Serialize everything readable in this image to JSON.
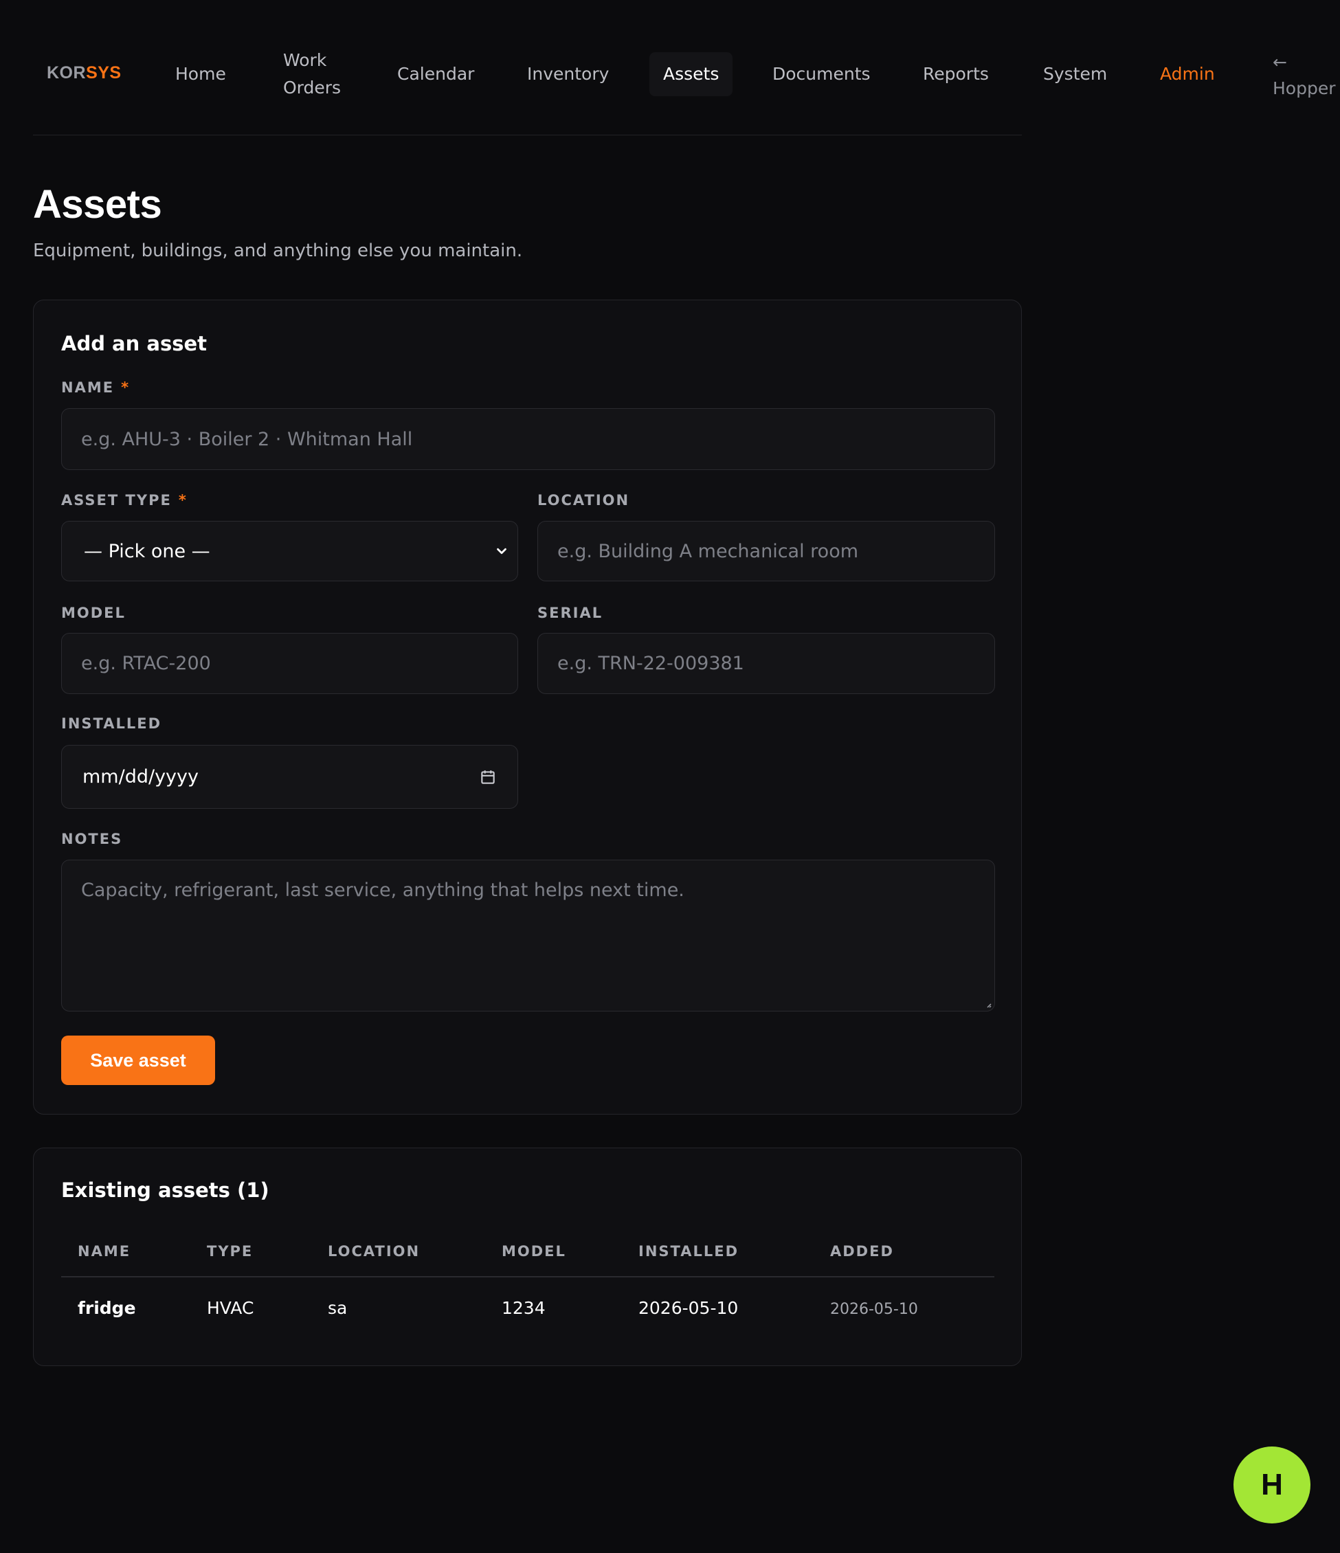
{
  "brand": {
    "part1": "KOR",
    "part2": "SYS",
    "accent": "#f97316"
  },
  "nav": {
    "home": "Home",
    "work_orders_line1": "Work",
    "work_orders_line2": "Orders",
    "calendar": "Calendar",
    "inventory": "Inventory",
    "assets": "Assets",
    "documents": "Documents",
    "reports": "Reports",
    "system": "System",
    "admin": "Admin",
    "back_arrow": "←",
    "back_label": "Hopper"
  },
  "page": {
    "title": "Assets",
    "subtitle": "Equipment, buildings, and anything else you maintain."
  },
  "form": {
    "title": "Add an asset",
    "required_marker": "*",
    "name": {
      "label": "NAME",
      "placeholder": "e.g. AHU-3 · Boiler 2 · Whitman Hall"
    },
    "asset_type": {
      "label": "ASSET TYPE",
      "selected": "— Pick one —"
    },
    "location": {
      "label": "LOCATION",
      "placeholder": "e.g. Building A mechanical room"
    },
    "model": {
      "label": "MODEL",
      "placeholder": "e.g. RTAC-200"
    },
    "serial": {
      "label": "SERIAL",
      "placeholder": "e.g. TRN-22-009381"
    },
    "installed": {
      "label": "INSTALLED",
      "value": "mm/dd/yyyy"
    },
    "notes": {
      "label": "NOTES",
      "placeholder": "Capacity, refrigerant, last service, anything that helps next time."
    },
    "save_label": "Save asset"
  },
  "list": {
    "title": "Existing assets (1)",
    "columns": [
      "NAME",
      "TYPE",
      "LOCATION",
      "MODEL",
      "INSTALLED",
      "ADDED"
    ],
    "rows": [
      {
        "name": "fridge",
        "type": "HVAC",
        "location": "sa",
        "model": "1234",
        "installed": "2026-05-10",
        "added": "2026-05-10"
      }
    ]
  },
  "avatar": {
    "initial": "H",
    "color": "#a3e635"
  }
}
